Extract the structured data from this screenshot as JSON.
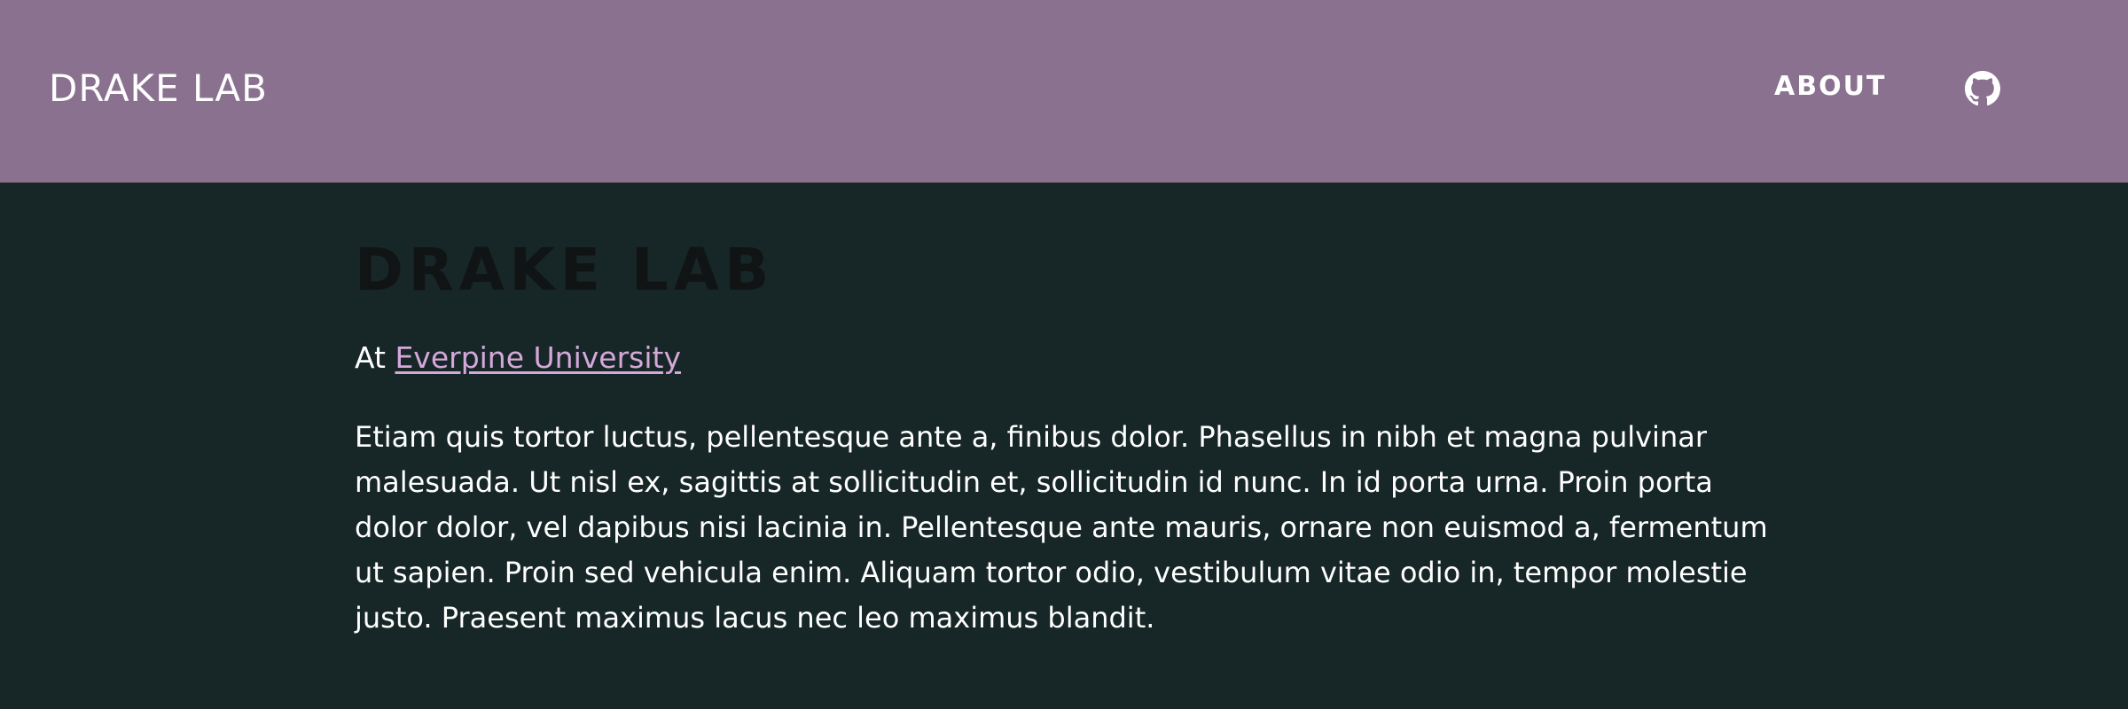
{
  "header": {
    "brand": "DRAKE LAB",
    "nav_about": "ABOUT",
    "github_icon": "github-icon"
  },
  "main": {
    "title": "DRAKE LAB",
    "affiliation_prefix": "At",
    "affiliation_link": "Everpine University",
    "bio": "Etiam quis tortor luctus, pellentesque ante a, finibus dolor. Phasellus in nibh et magna pulvinar malesuada. Ut nisl ex, sagittis at sollicitudin et, sollicitudin id nunc. In id porta urna. Proin porta dolor dolor, vel dapibus nisi lacinia in. Pellentesque ante mauris, ornare non euismod a, fermentum ut sapien. Proin sed vehicula enim. Aliquam tortor odio, vestibulum vitae odio in, tempor molestie justo. Praesent maximus lacus nec leo maximus blandit."
  },
  "colors": {
    "header_bg": "#89718f",
    "page_bg": "#172626",
    "link": "#d4a8d9",
    "title": "#111414",
    "text": "#ffffff"
  }
}
